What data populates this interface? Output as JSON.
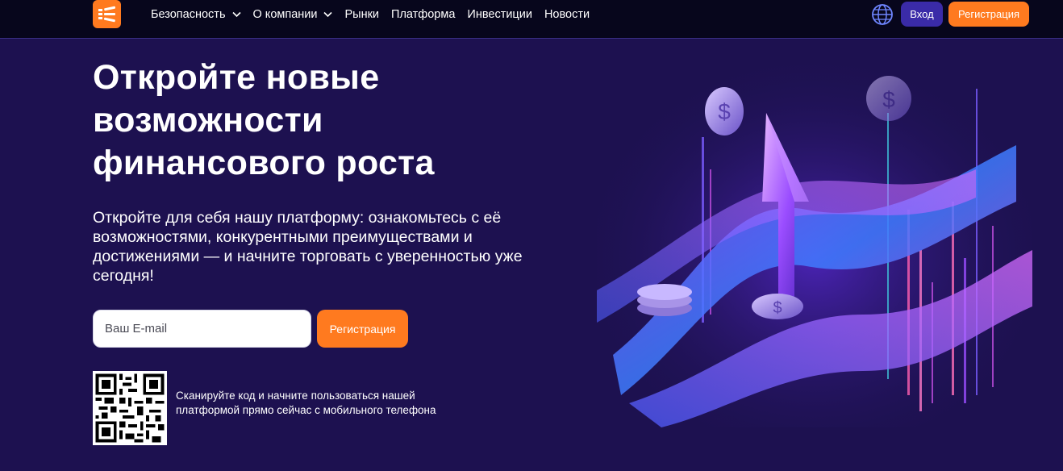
{
  "header": {
    "logo": "brand-logo",
    "nav": [
      {
        "label": "Безопасность",
        "dropdown": true
      },
      {
        "label": "О компании",
        "dropdown": true
      },
      {
        "label": "Рынки",
        "dropdown": false
      },
      {
        "label": "Платформа",
        "dropdown": false
      },
      {
        "label": "Инвестиции",
        "dropdown": false
      },
      {
        "label": "Новости",
        "dropdown": false
      }
    ],
    "language_icon": "globe-icon",
    "login_label": "Вход",
    "register_label": "Регистрация"
  },
  "hero": {
    "title": "Откройте новые возможности финансового роста",
    "subtitle": "Откройте для себя нашу платформу: ознакомьтесь с её возможностями, конкурентными преимуществами и достижениями — и начните торговать с уверенностью уже сегодня!",
    "email_placeholder": "Ваш E-mail",
    "register_label": "Регистрация",
    "qr_text": "Сканируйте код и начните пользоваться нашей платформой прямо сейчас с мобильного телефона"
  },
  "colors": {
    "background": "#1d1150",
    "topbar": "#07061c",
    "accent": "#ff7a1f",
    "login_button": "#3a2ba8"
  }
}
